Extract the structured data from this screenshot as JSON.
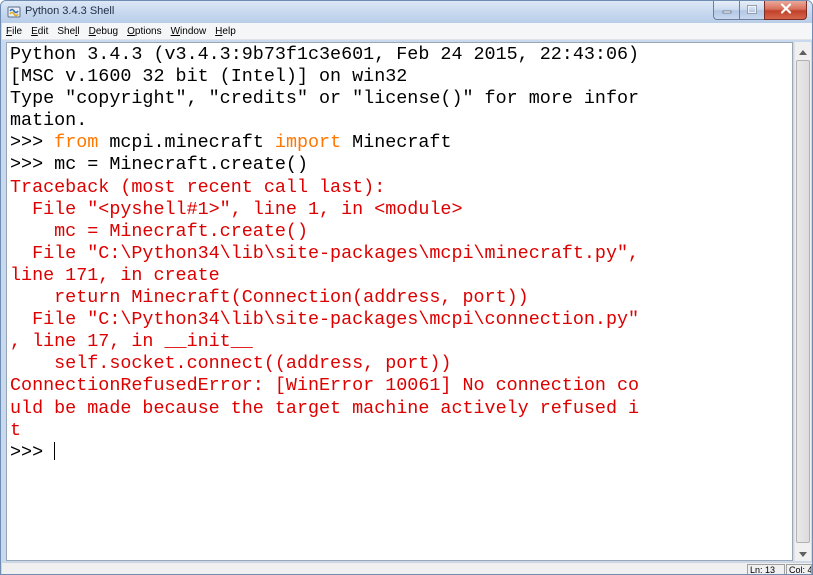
{
  "window": {
    "title": "Python 3.4.3 Shell"
  },
  "menu": [
    {
      "pre": "",
      "u": "F",
      "post": "ile"
    },
    {
      "pre": "",
      "u": "E",
      "post": "dit"
    },
    {
      "pre": "She",
      "u": "l",
      "post": "l"
    },
    {
      "pre": "",
      "u": "D",
      "post": "ebug"
    },
    {
      "pre": "",
      "u": "O",
      "post": "ptions"
    },
    {
      "pre": "",
      "u": "W",
      "post": "indow"
    },
    {
      "pre": "",
      "u": "H",
      "post": "elp"
    }
  ],
  "shell_lines": [
    [
      {
        "t": "Python 3.4.3 (v3.4.3:9b73f1c3e601, Feb 24 2015, 22:43:06)",
        "c": "out"
      }
    ],
    [
      {
        "t": "[MSC v.1600 32 bit (Intel)] on win32",
        "c": "out"
      }
    ],
    [
      {
        "t": "Type \"copyright\", \"credits\" or \"license()\" for more infor",
        "c": "out"
      }
    ],
    [
      {
        "t": "mation.",
        "c": "out"
      }
    ],
    [
      {
        "t": ">>> ",
        "c": "prompt"
      },
      {
        "t": "from",
        "c": "kw"
      },
      {
        "t": " mcpi.minecraft ",
        "c": "out"
      },
      {
        "t": "import",
        "c": "kw"
      },
      {
        "t": " Minecraft",
        "c": "out"
      }
    ],
    [
      {
        "t": ">>> ",
        "c": "prompt"
      },
      {
        "t": "mc = Minecraft.create()",
        "c": "out"
      }
    ],
    [
      {
        "t": "Traceback (most recent call last):",
        "c": "err"
      }
    ],
    [
      {
        "t": "  File \"<pyshell#1>\", line 1, in <module>",
        "c": "err"
      }
    ],
    [
      {
        "t": "    mc = Minecraft.create()",
        "c": "err"
      }
    ],
    [
      {
        "t": "  File \"C:\\Python34\\lib\\site-packages\\mcpi\\minecraft.py\",",
        "c": "err"
      }
    ],
    [
      {
        "t": "line 171, in create",
        "c": "err"
      }
    ],
    [
      {
        "t": "    return Minecraft(Connection(address, port))",
        "c": "err"
      }
    ],
    [
      {
        "t": "  File \"C:\\Python34\\lib\\site-packages\\mcpi\\connection.py\"",
        "c": "err"
      }
    ],
    [
      {
        "t": ", line 17, in __init__",
        "c": "err"
      }
    ],
    [
      {
        "t": "    self.socket.connect((address, port))",
        "c": "err"
      }
    ],
    [
      {
        "t": "ConnectionRefusedError: [WinError 10061] No connection co",
        "c": "err"
      }
    ],
    [
      {
        "t": "uld be made because the target machine actively refused i",
        "c": "err"
      }
    ],
    [
      {
        "t": "t",
        "c": "err"
      }
    ],
    [
      {
        "t": ">>> ",
        "c": "prompt"
      }
    ]
  ],
  "status": {
    "line": "Ln: 13",
    "col": "Col: 4"
  },
  "colors": {
    "keyword": "#ff7700",
    "error": "#dd0000",
    "output": "#000000"
  },
  "icons": {
    "app": "python-idle-icon",
    "minimize": "minimize-icon",
    "maximize": "maximize-icon",
    "close": "close-icon"
  }
}
